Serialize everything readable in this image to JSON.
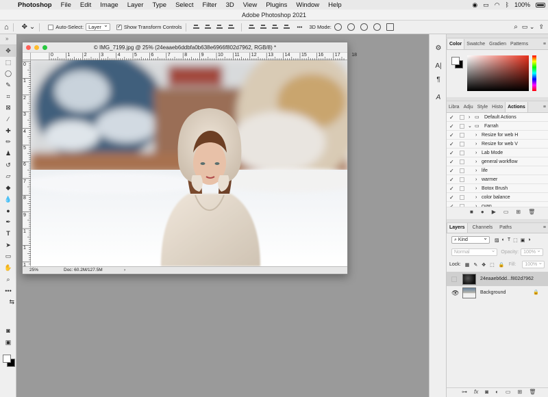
{
  "menubar": {
    "apple": "",
    "app": "Photoshop",
    "items": [
      "File",
      "Edit",
      "Image",
      "Layer",
      "Type",
      "Select",
      "Filter",
      "3D",
      "View",
      "Plugins",
      "Window",
      "Help"
    ],
    "battery": "100%"
  },
  "window": {
    "title": "Adobe Photoshop 2021"
  },
  "options": {
    "auto_select_label": "Auto-Select:",
    "auto_select_value": "Layer",
    "show_transform_label": "Show Transform Controls",
    "mode_3d_label": "3D Mode:"
  },
  "document": {
    "title": "© IMG_7199.jpg @ 25% (24eaaeb6ddbfa0b638e6966f802d7962, RGB/8) *",
    "zoom": "25%",
    "doc_size": "Doc: 60.2M/127.5M",
    "ruler_top": [
      "0",
      "1",
      "2",
      "3",
      "4",
      "5",
      "6",
      "7",
      "8",
      "9",
      "10",
      "11",
      "12",
      "13",
      "14",
      "15",
      "16",
      "17",
      "18"
    ],
    "ruler_left": [
      "0",
      "1",
      "2",
      "3",
      "4",
      "5",
      "6",
      "7",
      "8",
      "9",
      "1",
      "1",
      "1"
    ]
  },
  "color_panel": {
    "tabs": [
      "Color",
      "Swatche",
      "Gradien",
      "Patterns"
    ],
    "active_tab": "Color"
  },
  "actions_panel": {
    "tabs": [
      "Libra",
      "Adju",
      "Style",
      "Histo",
      "Actions"
    ],
    "items": [
      {
        "label": "Default Actions",
        "type": "set",
        "expanded": false
      },
      {
        "label": "Farrah",
        "type": "set",
        "expanded": true
      },
      {
        "label": "Resize for web H",
        "type": "action"
      },
      {
        "label": "Resize for web V",
        "type": "action"
      },
      {
        "label": "Lab Mode",
        "type": "action"
      },
      {
        "label": "general workflow",
        "type": "action"
      },
      {
        "label": "life",
        "type": "action"
      },
      {
        "label": "warmer",
        "type": "action"
      },
      {
        "label": "Botox Brush",
        "type": "action"
      },
      {
        "label": "color balance",
        "type": "action"
      },
      {
        "label": "cyan",
        "type": "action"
      }
    ]
  },
  "layers_panel": {
    "tabs": [
      "Layers",
      "Channels",
      "Paths"
    ],
    "filter_kind": "Kind",
    "blend_mode": "Normal",
    "opacity_label": "Opacity:",
    "opacity_value": "100%",
    "lock_label": "Lock:",
    "fill_label": "Fill:",
    "fill_value": "100%",
    "layers": [
      {
        "name": "24eaaeb6dd...f802d7962",
        "visible": false,
        "selected": true
      },
      {
        "name": "Background",
        "visible": true,
        "selected": false,
        "locked": true
      }
    ]
  },
  "colors": {
    "accent_red": "#ff5f57",
    "accent_yellow": "#febc2e",
    "accent_green": "#28c840",
    "picker_hue": "#e8301c"
  }
}
